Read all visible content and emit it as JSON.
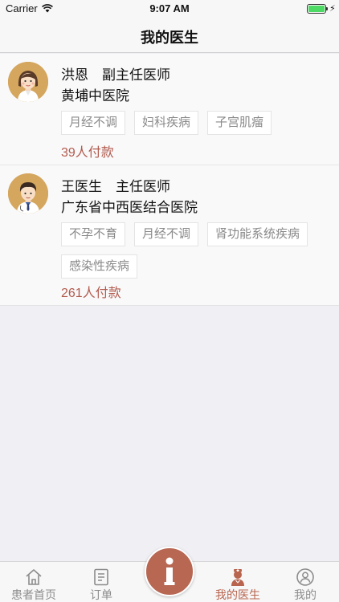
{
  "status_bar": {
    "carrier": "Carrier",
    "time": "9:07 AM",
    "battery_level": 1.0
  },
  "nav": {
    "title": "我的医生"
  },
  "doctors": [
    {
      "name": "洪恩",
      "title": "副主任医师",
      "hospital": "黄埔中医院",
      "tags": [
        "月经不调",
        "妇科疾病",
        "子宫肌瘤"
      ],
      "paid": "39人付款",
      "avatar_icon": "female-doctor-avatar"
    },
    {
      "name": "王医生",
      "title": "主任医师",
      "hospital": "广东省中西医结合医院",
      "tags": [
        "不孕不育",
        "月经不调",
        "肾功能系统疾病",
        "感染性疾病"
      ],
      "paid": "261人付款",
      "avatar_icon": "male-doctor-avatar"
    }
  ],
  "tab_bar": {
    "items": [
      {
        "label": "患者首页",
        "icon": "home-icon",
        "active": false
      },
      {
        "label": "订单",
        "icon": "order-list-icon",
        "active": false
      },
      {
        "label": "",
        "icon": "info-icon",
        "active": false
      },
      {
        "label": "我的医生",
        "icon": "doctor-icon",
        "active": true
      },
      {
        "label": "我的",
        "icon": "user-icon",
        "active": false
      }
    ]
  },
  "colors": {
    "accent": "#b8644e",
    "paid_text": "#b25b4f",
    "background": "#efeff4",
    "card": "#f9f9f9",
    "tag_text": "#8a8a8a",
    "battery": "#4cd964"
  }
}
